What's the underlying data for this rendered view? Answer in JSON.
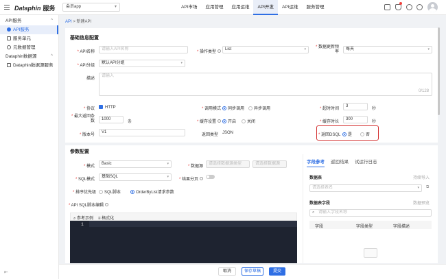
{
  "app": {
    "brand": "Dataphin",
    "service": "服务",
    "app_selector": "会员app"
  },
  "nav": [
    "API市场",
    "应用管理",
    "应用运维",
    "API开发",
    "API运维",
    "服务管理"
  ],
  "nav_active": "API开发",
  "sidebar": {
    "group1": "API服务",
    "items1": [
      "API服务",
      "服务单元",
      "元数据管理"
    ],
    "group2": "Dataphin数据源",
    "items2": [
      "Dataphin数据源服务"
    ]
  },
  "breadcrumb": {
    "root": "API",
    "sep": ">",
    "current": "新建API"
  },
  "basic": {
    "section_title": "基础信息配置",
    "api_name_label": "API名称",
    "api_name_placeholder": "请输入API名称",
    "op_type_label": "操作类型",
    "op_type_value": "List",
    "update_freq_label": "数据更新频率",
    "update_freq_value": "每天",
    "api_group_label": "API分组",
    "api_group_value": "默认API分组",
    "desc_label": "描述",
    "desc_placeholder": "请输入",
    "desc_count": "0/128",
    "protocol_label": "协议",
    "protocol_value": "HTTP",
    "call_mode_label": "调用模式",
    "call_sync": "同步调用",
    "call_async": "异步调用",
    "timeout_label": "超时时间",
    "timeout_value": "3",
    "timeout_unit": "秒",
    "max_return_label": "最大返回条数",
    "max_return_value": "1000",
    "max_return_unit": "条",
    "cache_label": "缓存设置",
    "cache_on": "开启",
    "cache_off": "关闭",
    "cache_time_label": "缓存时长",
    "cache_time_value": "300",
    "cache_time_unit": "秒",
    "version_label": "版本号",
    "version_value": "V1",
    "return_type_label": "返回类型",
    "return_type_value": "JSON",
    "dsql_label": "返回DSQL",
    "dsql_yes": "是",
    "dsql_no": "否"
  },
  "params": {
    "section_title": "参数配置",
    "mode_label": "模式",
    "mode_value": "Basic",
    "datasource_label": "数据源",
    "datasource_placeholder": "请选择数据源类型",
    "datasource_placeholder2": "请选择数据源",
    "sql_mode_label": "SQL模式",
    "sql_mode_value": "基础SQL",
    "paging_label": "结果分页",
    "priority_label": "排序优先级",
    "priority_sql": "SQL脚本",
    "priority_orderby": "OrderByList请求参数",
    "script_label": "API SQL脚本编辑",
    "ref_example": "参考示例",
    "format": "格式化",
    "line_number": "1"
  },
  "right_panel": {
    "tabs": [
      "字段参考",
      "返回结果",
      "试运行日志"
    ],
    "active_tab": "字段参考",
    "table_label": "数据表",
    "table_action": "持续导入",
    "table_placeholder": "请选择表名",
    "fields_label": "数据表字段",
    "fields_action": "数据预览",
    "search_placeholder": "请输入字段名称",
    "col_field": "字段",
    "col_type": "字段类型",
    "col_desc": "字段描述"
  },
  "footer": {
    "cancel": "取消",
    "save_draft": "保存草稿",
    "submit": "提交"
  },
  "colors": {
    "primary": "#2f6fe4",
    "highlight": "#d32f2f"
  }
}
